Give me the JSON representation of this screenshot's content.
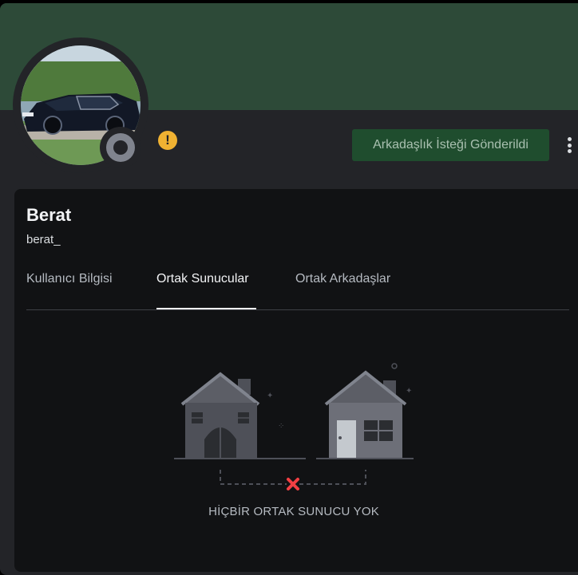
{
  "profile": {
    "display_name": "Berat",
    "username": "berat_",
    "friend_request_button": "Arkadaşlık İsteği Gönderildi",
    "status": "offline"
  },
  "tabs": [
    {
      "label": "Kullanıcı Bilgisi",
      "active": false
    },
    {
      "label": "Ortak Sunucular",
      "active": true
    },
    {
      "label": "Ortak Arkadaşlar",
      "active": false
    }
  ],
  "empty_state": {
    "message": "HİÇBİR ORTAK SUNUCU YOK"
  },
  "colors": {
    "banner": "#2d4a38",
    "button": "#1f4d2e",
    "warning": "#f0b232",
    "error_x": "#f23f43"
  }
}
